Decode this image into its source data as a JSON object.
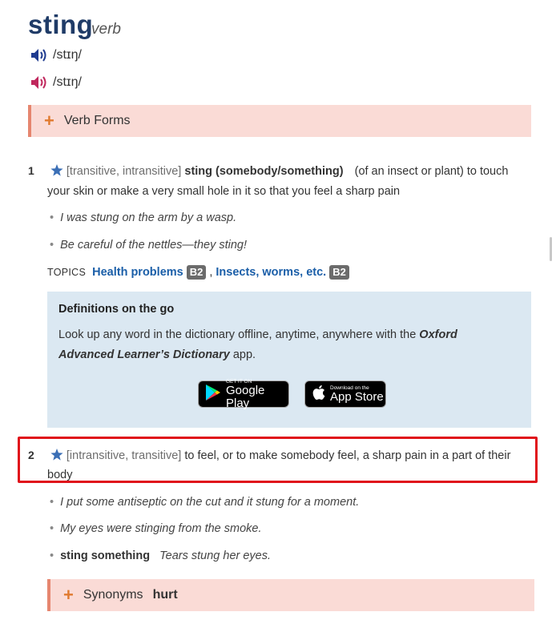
{
  "entry": {
    "headword": "sting",
    "pos": "verb",
    "pron_uk": "/stɪŋ/",
    "pron_us": "/stɪŋ/",
    "verb_forms_label": "Verb Forms"
  },
  "colors": {
    "headword": "#1f3b67",
    "uk_speaker": "#1f3b8f",
    "us_speaker": "#c0275d",
    "accent_plus": "#e07a2f",
    "highlight_border": "#e0121b",
    "link": "#1a5ea8"
  },
  "sense1": {
    "num": "1",
    "grammar": "[transitive, intransitive]",
    "pattern": "sting (somebody/something)",
    "def_line1": "(of an insect or plant) to touch",
    "def_line2": "your skin or make a very small hole in it so that you feel a sharp pain",
    "examples": [
      "I was stung on the arm by a wasp.",
      "Be careful of the nettles—they sting!"
    ],
    "topics_label": "TOPICS",
    "topics": [
      {
        "label": "Health problems",
        "level": "B2"
      },
      {
        "label": "Insects, worms, etc.",
        "level": "B2"
      }
    ],
    "topics_sep": ","
  },
  "promo": {
    "title": "Definitions on the go",
    "text_before": "Look up any word in the dictionary offline, anytime, anywhere with the ",
    "text_app_name_1": "Oxford",
    "text_app_name_2": "Advanced Learner’s Dictionary",
    "text_after": " app.",
    "google_small": "GET IT ON",
    "google_big": "Google Play",
    "apple_small": "Download on the",
    "apple_big": "App Store"
  },
  "sense2": {
    "num": "2",
    "grammar": "[intransitive, transitive]",
    "def_line1": "to feel, or to make somebody feel, a sharp pain in a part of their",
    "def_line2": "body",
    "examples": [
      "I put some antiseptic on the cut and it stung for a moment.",
      "My eyes were stinging from the smoke."
    ],
    "pattern_example": {
      "pattern": "sting something",
      "text": "Tears stung her eyes."
    }
  },
  "synonyms": {
    "label": "Synonyms",
    "word": "hurt"
  }
}
